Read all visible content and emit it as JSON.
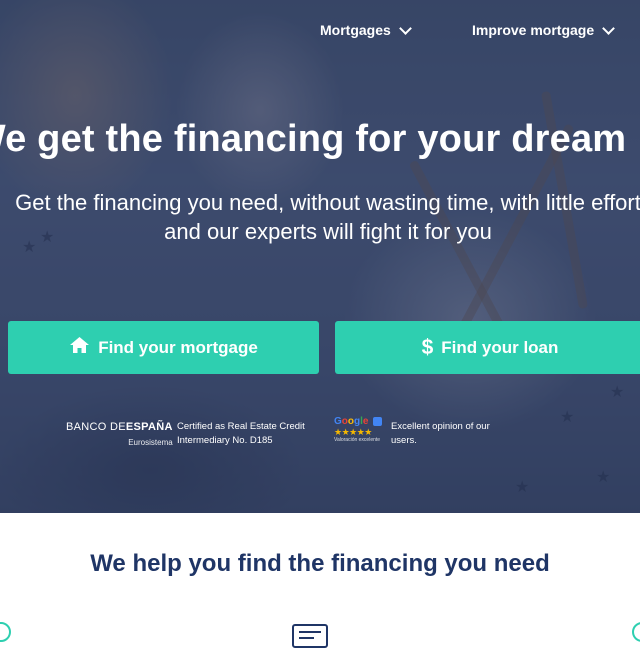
{
  "nav": {
    "items": [
      {
        "label": "Mortgages",
        "icon": "chevron-down-icon"
      },
      {
        "label": "Improve mortgage",
        "icon": "chevron-down-icon"
      }
    ]
  },
  "hero": {
    "headline": "We get the financing for your dream",
    "subline_1": "Get the financing you need, without wasting time, with little effort",
    "subline_2": "and our experts will fight it for you",
    "cta_mortgage": {
      "label": "Find your mortgage",
      "icon": "home-icon"
    },
    "cta_loan": {
      "label": "Find your loan",
      "icon": "dollar-icon"
    },
    "bde": {
      "brand_1": "BANCO DE",
      "brand_2": "ESPAÑA",
      "brand_sub": "Eurosistema"
    },
    "certified_line_1": "Certified as Real Estate Credit",
    "certified_line_2": "Intermediary No. D185",
    "google": {
      "word": "Google",
      "caption": "Valoración excelente"
    },
    "opinion_line_1": "Excellent opinion of our",
    "opinion_line_2": "users."
  },
  "section": {
    "title": "We help you find the financing you need"
  },
  "colors": {
    "accent": "#2ecfb0",
    "heading": "#1f3566",
    "overlay": "#2f3d63"
  }
}
